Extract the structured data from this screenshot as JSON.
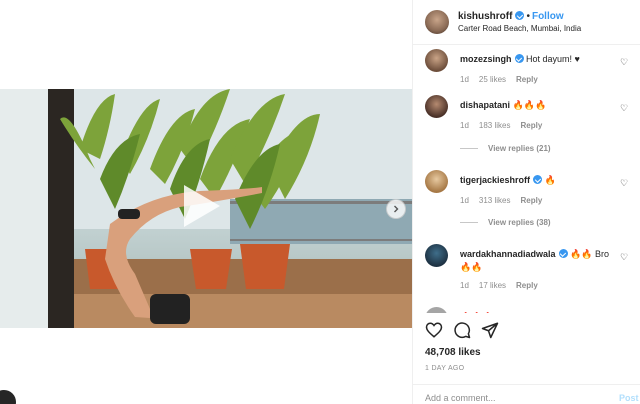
{
  "post": {
    "username": "kishushroff",
    "follow_label": "Follow",
    "separator": "•",
    "location": "Carter Road Beach, Mumbai, India",
    "likes": "48,708 likes",
    "time": "1 DAY AGO",
    "add_comment_placeholder": "Add a comment...",
    "post_label": "Post"
  },
  "comments": [
    {
      "username": "mozezsingh",
      "text": "Hot dayum! ♥",
      "time": "1d",
      "likes": "25 likes",
      "reply": "Reply"
    },
    {
      "username": "dishapatani",
      "text": "🔥🔥🔥",
      "time": "1d",
      "likes": "183 likes",
      "reply": "Reply",
      "view_replies": "View replies (21)"
    },
    {
      "username": "tigerjackieshroff",
      "text": "🔥",
      "time": "1d",
      "likes": "313 likes",
      "reply": "Reply",
      "view_replies": "View replies (38)"
    },
    {
      "username": "wardakhannadiadwala",
      "text": "🔥🔥 Bro 🔥🔥",
      "time": "1d",
      "likes": "17 likes",
      "reply": "Reply"
    },
    {
      "username": "",
      "text": "🔥🔥🔥"
    }
  ],
  "icons": {
    "like": "heart-icon",
    "comment": "comment-icon",
    "share": "share-icon",
    "play": "play-icon",
    "next": "chevron-right-icon",
    "verified": "verified-badge-icon"
  },
  "colors": {
    "link_blue": "#3897f0",
    "muted": "#8e8e8e",
    "text": "#262626",
    "border": "#efefef"
  }
}
